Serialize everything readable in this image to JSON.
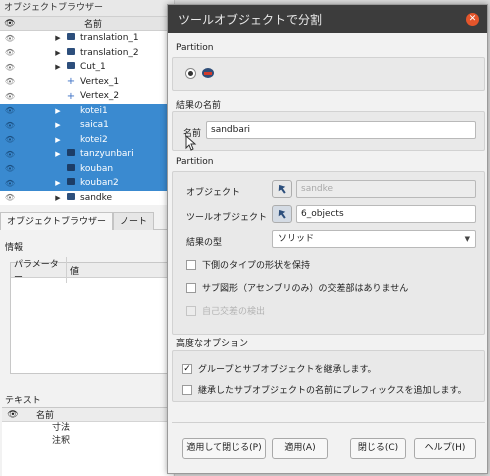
{
  "left_panel": {
    "title": "オブジェクトブラウザー",
    "header_name": "名前",
    "items": [
      {
        "label": "translation_1",
        "selected": false,
        "arrow": true,
        "icon": "cube"
      },
      {
        "label": "translation_2",
        "selected": false,
        "arrow": true,
        "icon": "cube"
      },
      {
        "label": "Cut_1",
        "selected": false,
        "arrow": true,
        "icon": "cube"
      },
      {
        "label": "Vertex_1",
        "selected": false,
        "arrow": false,
        "icon": "vertex"
      },
      {
        "label": "Vertex_2",
        "selected": false,
        "arrow": false,
        "icon": "vertex"
      },
      {
        "label": "kotei1",
        "selected": true,
        "arrow": true,
        "icon": "none"
      },
      {
        "label": "saica1",
        "selected": true,
        "arrow": true,
        "icon": "none"
      },
      {
        "label": "kotei2",
        "selected": true,
        "arrow": true,
        "icon": "none"
      },
      {
        "label": "tanzyunbari",
        "selected": true,
        "arrow": true,
        "icon": "cube"
      },
      {
        "label": "kouban",
        "selected": true,
        "arrow": false,
        "icon": "cube"
      },
      {
        "label": "kouban2",
        "selected": true,
        "arrow": true,
        "icon": "cube"
      },
      {
        "label": "sandke",
        "selected": false,
        "arrow": true,
        "icon": "cube"
      }
    ],
    "tabs": [
      "オブジェクトブラウザー",
      "ノート"
    ],
    "info_title": "情報",
    "param_header": [
      "パラメーター",
      "値"
    ],
    "text_title": "テキスト",
    "text_header": "名前",
    "text_items": [
      "寸法",
      "注釈"
    ]
  },
  "dialog": {
    "title": "ツールオブジェクトで分割",
    "partition_section": "Partition",
    "result_section": "結果の名前",
    "name_label": "名前",
    "name_value": "sandbari",
    "partition_section2": "Partition",
    "object_label": "オブジェクト",
    "object_value": "sandke",
    "tool_label": "ツールオブジェクト",
    "tool_value": "6_objects",
    "result_type_label": "結果の型",
    "result_type_value": "ソリッド",
    "check_keep_shapes": "下側のタイプの形状を保持",
    "check_no_intersect": "サブ図形（アセンブリのみ）の交差部はありません",
    "check_self_intersect": "自己交差の検出",
    "advanced_section": "高度なオプション",
    "check_inherit": "グループとサブオブジェクトを継承します。",
    "check_prefix": "継承したサブオブジェクトの名前にプレフィックスを追加します。",
    "btn_apply_close": "適用して閉じる(P)",
    "btn_apply": "適用(A)",
    "btn_close": "閉じる(C)",
    "btn_help": "ヘルプ(H)"
  },
  "colors": {
    "selection": "#3a8ad0",
    "titlebar": "#3c3c3c",
    "close": "#e4552b"
  }
}
